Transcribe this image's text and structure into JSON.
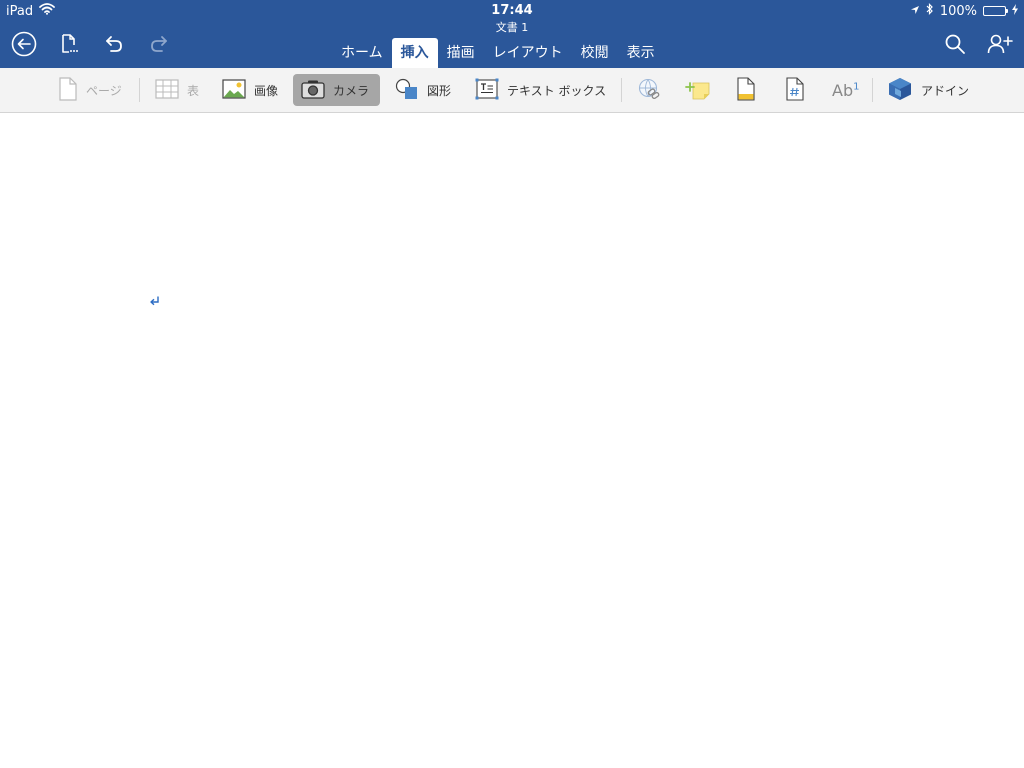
{
  "status_bar": {
    "device": "iPad",
    "time": "17:44",
    "battery": "100%"
  },
  "document": {
    "title": "文書 1"
  },
  "tabs": [
    {
      "label": "ホーム",
      "active": false
    },
    {
      "label": "挿入",
      "active": true
    },
    {
      "label": "描画",
      "active": false
    },
    {
      "label": "レイアウト",
      "active": false
    },
    {
      "label": "校閲",
      "active": false
    },
    {
      "label": "表示",
      "active": false
    }
  ],
  "ribbon": {
    "page_label": "ページ",
    "table_label": "表",
    "image_label": "画像",
    "camera_label": "カメラ",
    "shapes_label": "図形",
    "textbox_label": "テキスト ボックス",
    "footnote_label": "Ab",
    "footnote_sup": "1",
    "addins_label": "アドイン"
  },
  "colors": {
    "header_bg": "#2b579a",
    "ribbon_bg": "#f3f3f3",
    "accent_blue": "#4a86c8",
    "battery_green": "#4cd964"
  },
  "icons": [
    "wifi-icon",
    "location-icon",
    "bluetooth-icon",
    "battery-icon",
    "back-icon",
    "file-icon",
    "undo-icon",
    "redo-icon",
    "search-icon",
    "share-icon",
    "page-icon",
    "table-icon",
    "image-icon",
    "camera-icon",
    "shapes-icon",
    "textbox-icon",
    "link-icon",
    "comment-icon",
    "header-footer-icon",
    "page-number-icon",
    "addins-icon",
    "paragraph-mark-icon"
  ]
}
